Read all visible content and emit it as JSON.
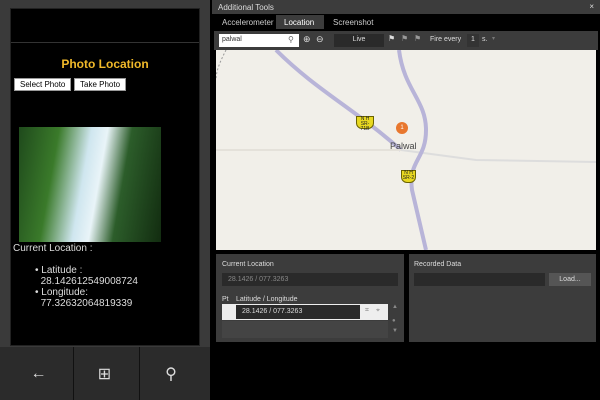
{
  "phone": {
    "title": "Photo Location",
    "select_photo": "Select Photo",
    "take_photo": "Take Photo",
    "current_location_label": "Current Location :",
    "latitude_label": "Latitude :",
    "latitude_value": "28.142612549008724",
    "longitude_label": "Longitude:",
    "longitude_value": "77.32632064819339",
    "nav": {
      "back": "←",
      "start": "⊞",
      "search": "⚲"
    }
  },
  "tools": {
    "window_title": "Additional Tools",
    "close": "×",
    "tabs": [
      "Accelerometer",
      "Location",
      "Screenshot"
    ],
    "active_tab": "Location",
    "toolbar": {
      "search_value": "palwal",
      "live_label": "Live",
      "fire_every_label": "Fire every",
      "fire_every_value": "1",
      "fire_every_unit": "s."
    },
    "map": {
      "place": "Palwal",
      "pin_number": "1",
      "shields": [
        {
          "top": "N H",
          "bottom": "SR-71B"
        },
        {
          "top": "N H",
          "bottom": "SR-2"
        }
      ],
      "road_color": "#b8b4d8"
    },
    "current_location": {
      "label": "Current Location",
      "value": "28.1426 /  077.3263"
    },
    "points": {
      "pt_label": "Pt",
      "header": "Latitude / Longitude",
      "rows": [
        {
          "value": "28.1426 /  077.3263"
        }
      ]
    },
    "recorded": {
      "label": "Recorded Data",
      "value": "",
      "load_button": "Load..."
    }
  }
}
